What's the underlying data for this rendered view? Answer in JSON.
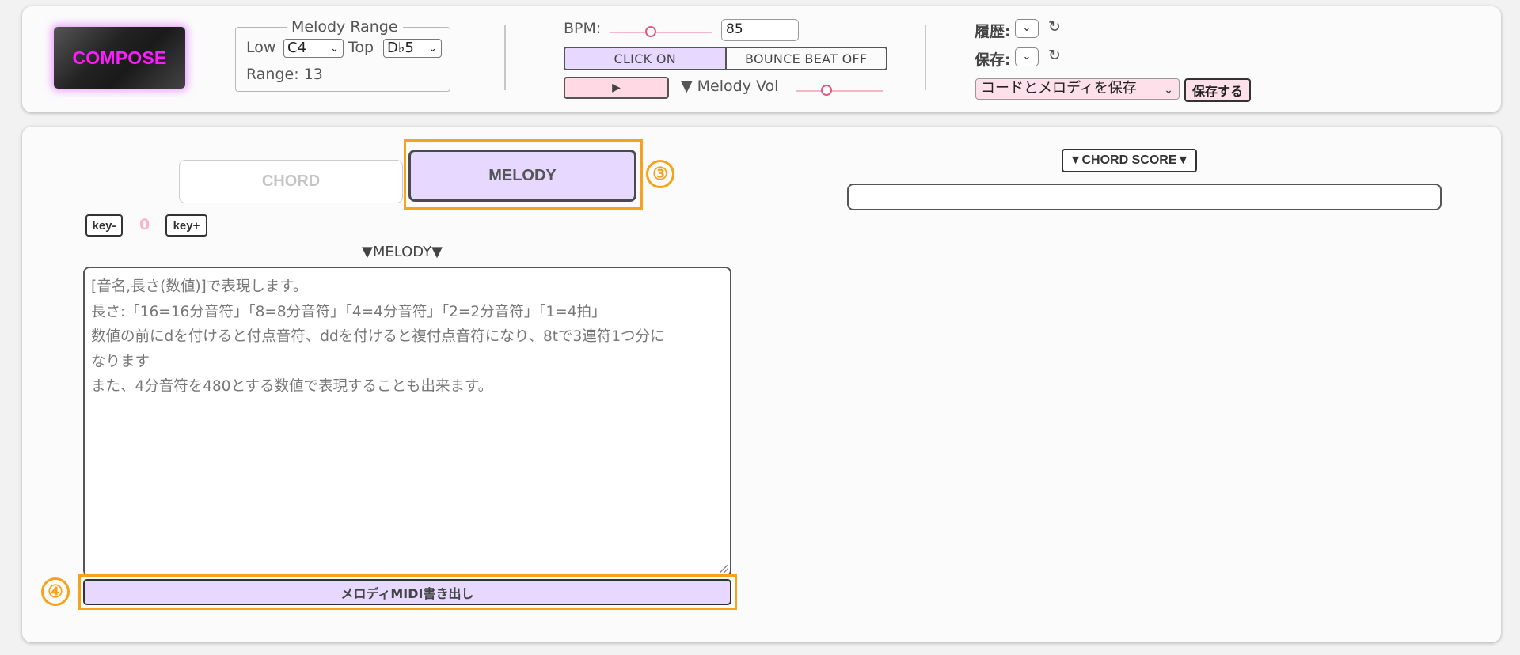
{
  "header": {
    "compose_label": "COMPOSE",
    "melody_range": {
      "legend": "Melody Range",
      "low_label": "Low",
      "low_value": "C4",
      "top_label": "Top",
      "top_value": "D♭5",
      "range_text": "Range: 13"
    },
    "bpm": {
      "label": "BPM:",
      "value": "85",
      "slider_fraction": 0.4
    },
    "click_toggle": {
      "on_label": "CLICK ON",
      "bounce_label": "BOUNCE BEAT OFF"
    },
    "play_label": "▶",
    "melody_vol": {
      "label": "▼ Melody Vol",
      "slider_fraction": 0.35
    },
    "history_label": "履歴:",
    "save_label": "保存:",
    "save_select_value": "コードとメロディを保存",
    "save_button_label": "保存する"
  },
  "main": {
    "tabs": {
      "chord": "CHORD",
      "melody": "MELODY"
    },
    "badge_3": "③",
    "badge_4": "④",
    "key_minus": "key-",
    "key_value": "0",
    "key_plus": "key+",
    "melody_title": "▼MELODY▼",
    "melody_placeholder_lines": [
      "[音名,長さ(数値)]で表現します。",
      "長さ:「16=16分音符」「8=8分音符」「4=4分音符」「2=2分音符」「1=4拍」",
      "数値の前にdを付けると付点音符、ddを付けると複付点音符になり、8tで3連符1つ分に",
      "なります",
      "また、4分音符を480とする数値で表現することも出来ます。"
    ],
    "midi_button_label": "メロディMIDI書き出し",
    "chord_score_title": "▼CHORD SCORE▼"
  },
  "colors": {
    "accent_purple": "#e6d8ff",
    "accent_pink": "#fde0ea",
    "highlight_orange": "#f6a21c",
    "compose_text": "#ff1cff"
  }
}
